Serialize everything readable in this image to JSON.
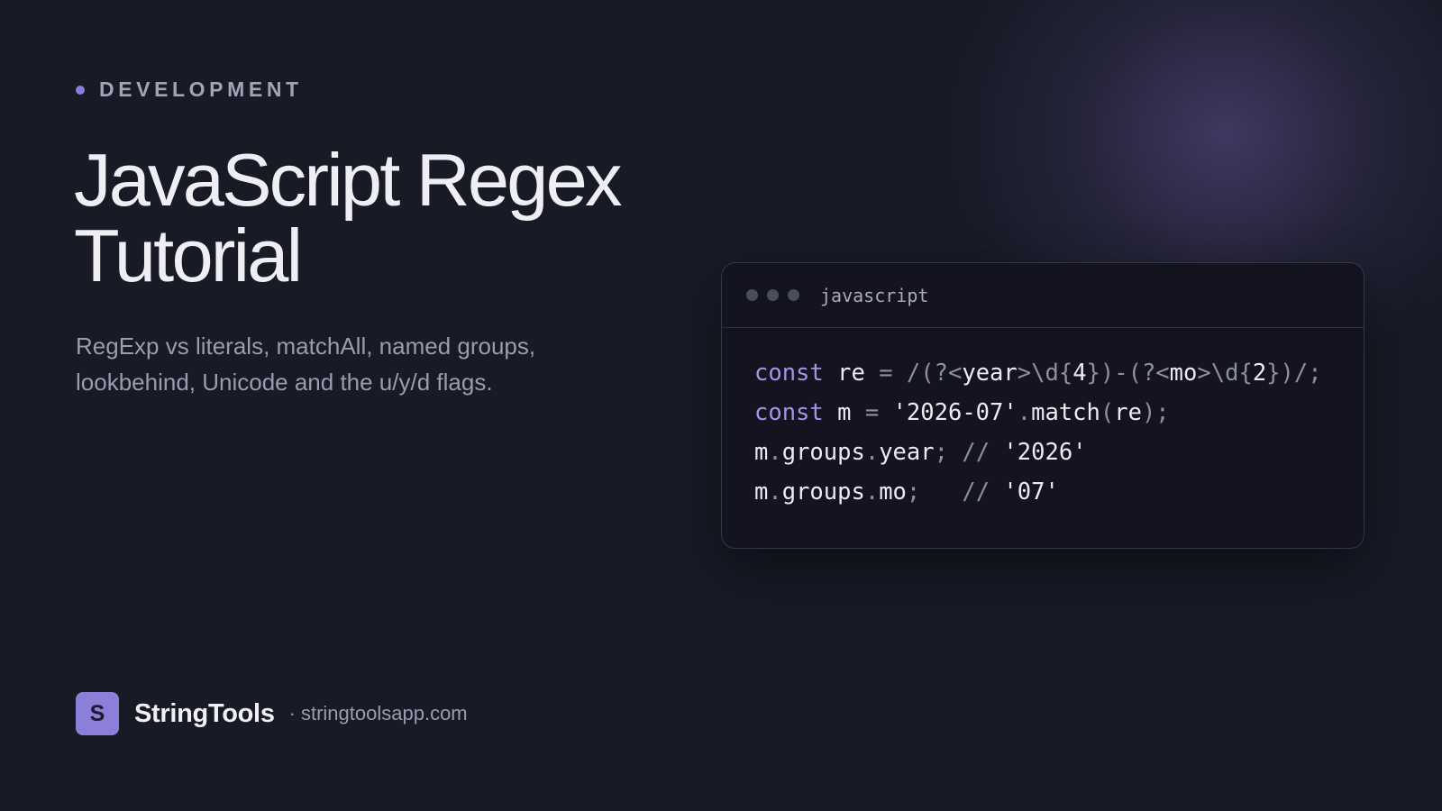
{
  "category": "DEVELOPMENT",
  "title_line1": "JavaScript Regex",
  "title_line2": "Tutorial",
  "subtitle_line1": "RegExp vs literals, matchAll, named groups,",
  "subtitle_line2": "lookbehind, Unicode and the u/y/d flags.",
  "code": {
    "language": "javascript",
    "lines": [
      [
        "const",
        "re",
        "=",
        "/(?<",
        "year",
        ">\\d{",
        "4",
        "})-(?<",
        "mo",
        ">\\d{",
        "2",
        "})/;"
      ],
      [
        "const",
        "m",
        "=",
        "'2026-07'",
        ".",
        "match",
        "(",
        "re",
        ");"
      ],
      [
        "m",
        ".",
        "groups",
        ".",
        "year",
        ";",
        "//",
        "'2026'"
      ],
      [
        "m",
        ".",
        "groups",
        ".",
        "mo",
        ";",
        "//",
        "'07'"
      ]
    ]
  },
  "brand": {
    "logo_letter": "S",
    "name": "StringTools",
    "separator": "·",
    "url": "stringtoolsapp.com"
  },
  "colors": {
    "background": "#181a26",
    "accent": "#8b7fd8",
    "keyword": "#a494e6"
  }
}
